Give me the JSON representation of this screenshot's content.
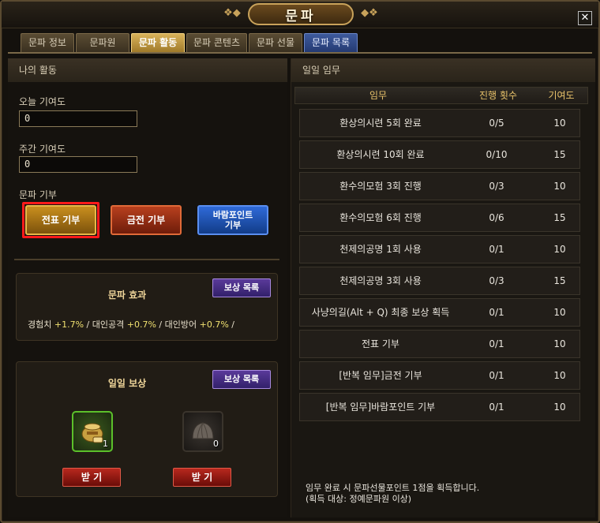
{
  "window": {
    "title": "문파",
    "close_glyph": "✕"
  },
  "tabs": [
    {
      "label": "문파 정보"
    },
    {
      "label": "문파원"
    },
    {
      "label": "문파 활동"
    },
    {
      "label": "문파 콘텐츠"
    },
    {
      "label": "문파 선물"
    },
    {
      "label": "문파 목록"
    }
  ],
  "left": {
    "header": "나의 활동",
    "today_label": "오늘 기여도",
    "today_value": "0",
    "weekly_label": "주간 기여도",
    "weekly_value": "0",
    "donate_label": "문파 기부",
    "donate_buttons": [
      "전표 기부",
      "금전 기부",
      "바람포인트\n기부"
    ],
    "effect": {
      "title": "문파 효과",
      "reward_btn": "보상 목록",
      "exp_label": "경험치",
      "exp_val": "+1.7%",
      "atk_label": "대인공격",
      "atk_val": "+0.7%",
      "def_label": "대인방어",
      "def_val": "+0.7%",
      "sep": "/"
    },
    "daily": {
      "title": "일일 보상",
      "reward_btn": "보상 목록",
      "items": [
        {
          "count": "1",
          "icon": "pot-icon"
        },
        {
          "count": "0",
          "icon": "dumpling-icon"
        }
      ],
      "receive_label": "받 기"
    }
  },
  "right": {
    "header": "일일 임무",
    "columns": [
      "임무",
      "진행 횟수",
      "기여도"
    ],
    "rows": [
      {
        "task": "환상의시련 5회 완료",
        "progress": "0/5",
        "points": "10"
      },
      {
        "task": "환상의시련 10회 완료",
        "progress": "0/10",
        "points": "15"
      },
      {
        "task": "환수의모험 3회 진행",
        "progress": "0/3",
        "points": "10"
      },
      {
        "task": "환수의모험 6회 진행",
        "progress": "0/6",
        "points": "15"
      },
      {
        "task": "천제의공명 1회 사용",
        "progress": "0/1",
        "points": "10"
      },
      {
        "task": "천제의공명 3회 사용",
        "progress": "0/3",
        "points": "15"
      },
      {
        "task": "사냥의길(Alt + Q) 최종 보상 획득",
        "progress": "0/1",
        "points": "10"
      },
      {
        "task": "전표 기부",
        "progress": "0/1",
        "points": "10"
      },
      {
        "task": "[반복 임무]금전 기부",
        "progress": "0/1",
        "points": "10"
      },
      {
        "task": "[반복 임무]바람포인트 기부",
        "progress": "0/1",
        "points": "10"
      }
    ],
    "footnote_1": "임무 완료 시 문파선물포인트 1점을 획득합니다.",
    "footnote_2": "(획득 대상: 정예문파원 이상)"
  }
}
